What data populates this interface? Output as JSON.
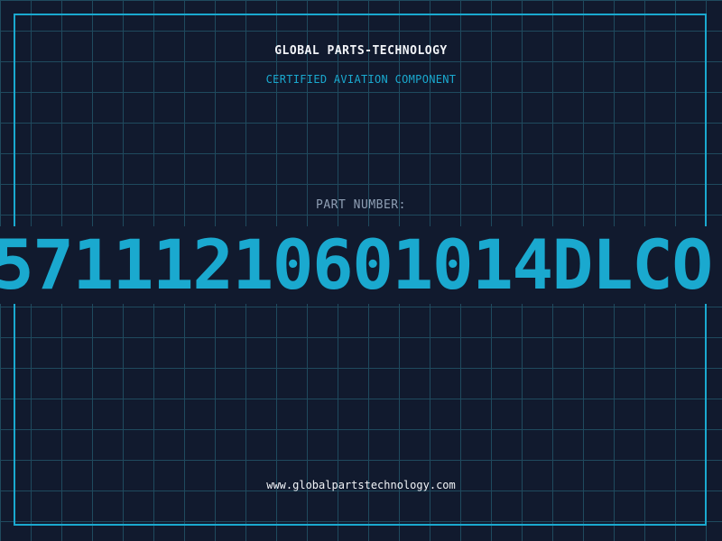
{
  "header": {
    "company": "GLOBAL PARTS-TECHNOLOGY",
    "tagline": "CERTIFIED AVIATION COMPONENT"
  },
  "part": {
    "label": "PART NUMBER:",
    "number": "571112106010 14DLCO"
  },
  "footer": {
    "website": "www.globalpartstechnology.com"
  },
  "colors": {
    "background": "#111a2e",
    "grid": "#1f4a5e",
    "accent": "#1aa9cf",
    "text": "#f2f4f8",
    "muted": "#8f9fb4"
  }
}
